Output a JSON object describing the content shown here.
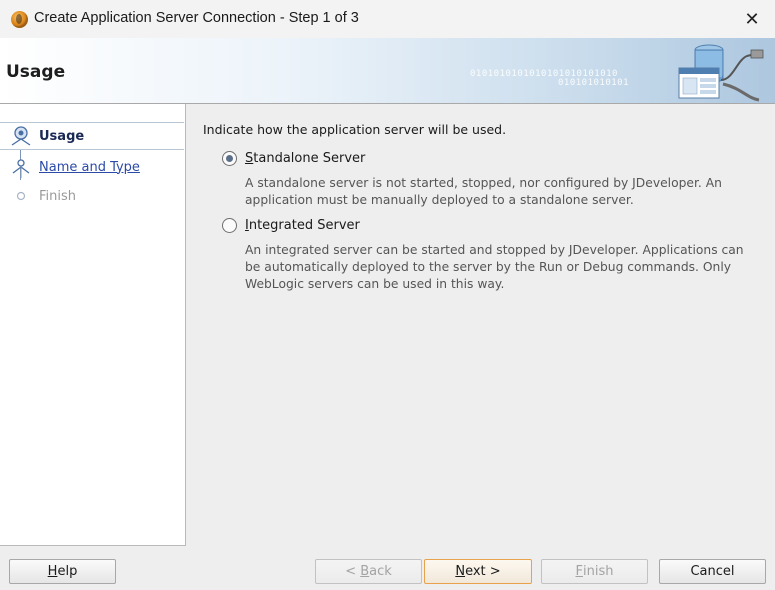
{
  "window": {
    "title": "Create Application Server Connection - Step 1 of 3",
    "close_glyph": "✕",
    "app_icon": "jdeveloper-icon"
  },
  "header": {
    "title": "Usage",
    "watermark_lines": [
      "0101010101010101010101010",
      "010101010101"
    ]
  },
  "nav": {
    "items": [
      {
        "label": "Usage",
        "state": "selected"
      },
      {
        "label": "Name and Type",
        "state": "link"
      },
      {
        "label": "Finish",
        "state": "disabled"
      }
    ]
  },
  "content": {
    "intro": "Indicate how  the application server will be used.",
    "options": [
      {
        "label": "Standalone Server",
        "mnemonic": "S",
        "rest": "tandalone Server",
        "checked": true,
        "description_lines": [
          "A standalone server is not started, stopped, nor configured by JDeveloper. An",
          "application must be manually deployed to a standalone server."
        ]
      },
      {
        "label": "Integrated Server",
        "mnemonic": "I",
        "rest": "ntegrated Server",
        "checked": false,
        "description_lines": [
          "An integrated server can be started and stopped by JDeveloper. Applications can",
          "be automatically deployed to the server by the Run or Debug commands. Only",
          "WebLogic servers can be used in this way."
        ]
      }
    ]
  },
  "buttons": {
    "help": {
      "label": "Help",
      "mn": "H",
      "rest": "elp"
    },
    "back": {
      "label": "< Back",
      "pre": "< ",
      "mn": "B",
      "rest": "ack",
      "enabled": false
    },
    "next": {
      "label": "Next >",
      "mn": "N",
      "rest": "ext >",
      "enabled": true
    },
    "finish": {
      "label": "Finish",
      "mn": "F",
      "rest": "inish",
      "enabled": false
    },
    "cancel": {
      "label": "Cancel",
      "enabled": true
    }
  },
  "colors": {
    "link": "#2c4aa8",
    "selected_label": "#1a2a55",
    "default_button_border": "#e7a24b",
    "description_text": "#555555"
  }
}
